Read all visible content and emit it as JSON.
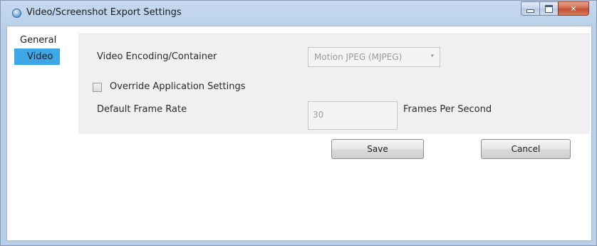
{
  "window": {
    "title": "Video/Screenshot Export Settings"
  },
  "nav": {
    "items": [
      {
        "label": "General",
        "selected": false
      },
      {
        "label": "Video",
        "selected": true
      }
    ]
  },
  "video_settings": {
    "encoding_label": "Video Encoding/Container",
    "encoding_value": "Motion JPEG (MJPEG)",
    "override_label": "Override Application Settings",
    "override_checked": false,
    "frame_rate_label": "Default Frame Rate",
    "frame_rate_value": "30",
    "frame_rate_unit": "Frames Per Second"
  },
  "buttons": {
    "save_label": "Save",
    "cancel_label": "Cancel"
  },
  "colors": {
    "selected_nav": "#3ea8e6",
    "close_button": "#c44d30",
    "titlebar": "#c5daf0"
  },
  "icons": {
    "app": "app-icon",
    "dropdown": "chevron-down-icon"
  }
}
